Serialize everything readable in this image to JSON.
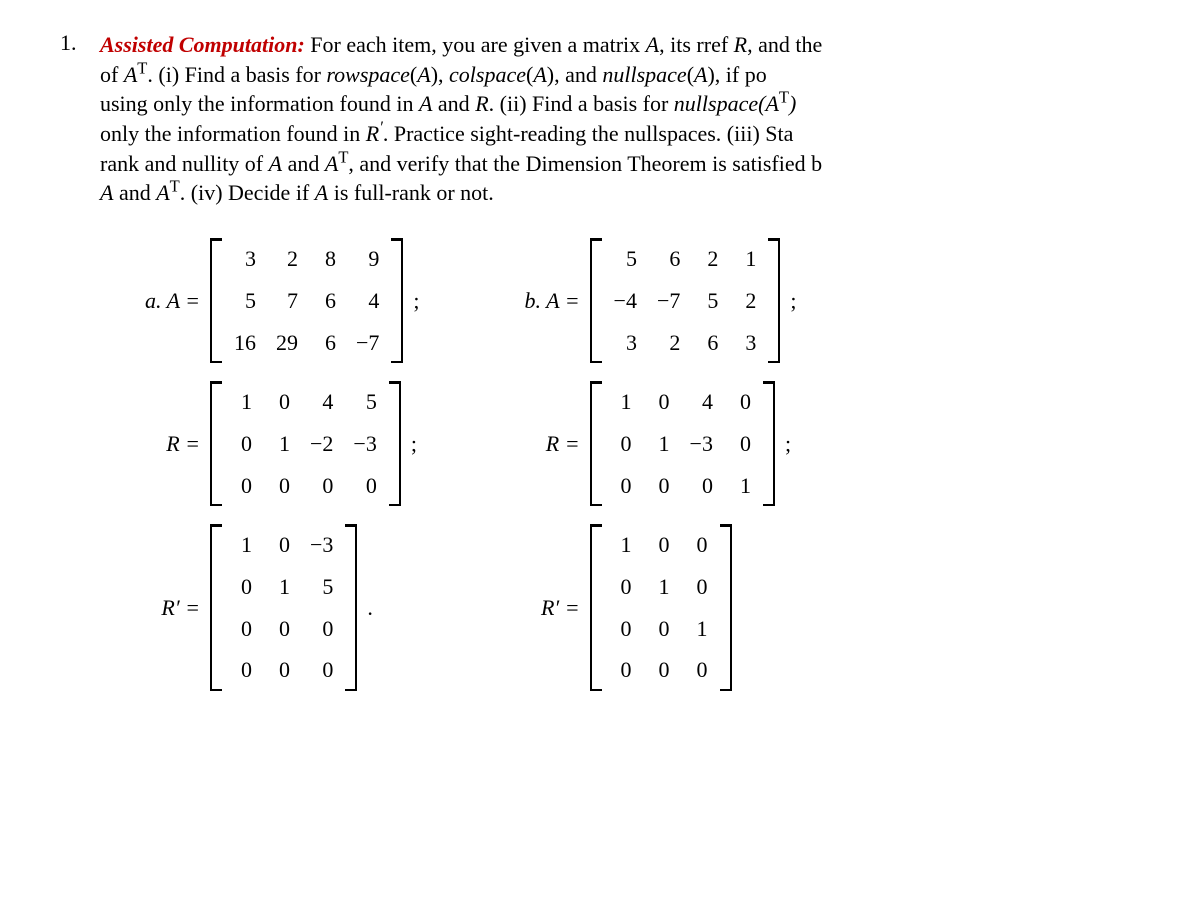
{
  "problem_number": "1.",
  "heading": "Assisted Computation:",
  "text_parts": {
    "p1": " For each item, you are given a matrix ",
    "A": "A",
    "p2": ",  its rref ",
    "R": "R",
    "p3": ",  and the",
    "p4": "of ",
    "AT": "A",
    "Tsup": "T",
    "p5": ". (i) Find a basis for ",
    "rowspace": "rowspace",
    "p6": "(",
    "A2": "A",
    "p7": "),  ",
    "colspace": "colspace",
    "p8": "(",
    "A3": "A",
    "p9": "),  and  ",
    "nullspace": "nullspace",
    "p10": "(",
    "A4": "A",
    "p11": "),  if  po",
    "p12": "using only the information found in ",
    "A5": "A",
    "p13": " and ",
    "R2": "R",
    "p14": ". (ii) Find a basis for ",
    "nullspace2": "nullspace(A",
    "Tsup2": "T",
    "paren2": ")",
    "p15": "only the information found in ",
    "R3": "R",
    "prime": "′",
    "p16": ". Practice sight-reading the nullspaces. (iii) Sta",
    "p17": "rank and nullity of ",
    "A6": "A",
    "p18": " and ",
    "A7": "A",
    "Tsup3": "T",
    "p19": ",  and verify that the Dimension Theorem is satisfied b",
    "p20": "",
    "A8": "A",
    "p21": " and ",
    "A9": "A",
    "Tsup4": "T",
    "p22": ". (iv) Decide if ",
    "A10": "A",
    "p23": " is full-rank or not."
  },
  "labels": {
    "a_A": "a.   A  =",
    "b_A": "b.   A  =",
    "R_eq": "R  =",
    "Rp_eq": "R′  =",
    "semicolon": ";",
    "period": "."
  },
  "chart_data": [
    {
      "type": "table",
      "name": "a.A",
      "rows": [
        [
          3,
          2,
          8,
          9
        ],
        [
          5,
          7,
          6,
          4
        ],
        [
          16,
          29,
          6,
          -7
        ]
      ]
    },
    {
      "type": "table",
      "name": "a.R",
      "rows": [
        [
          1,
          0,
          4,
          5
        ],
        [
          0,
          1,
          -2,
          -3
        ],
        [
          0,
          0,
          0,
          0
        ]
      ]
    },
    {
      "type": "table",
      "name": "a.Rprime",
      "rows": [
        [
          1,
          0,
          -3
        ],
        [
          0,
          1,
          5
        ],
        [
          0,
          0,
          0
        ],
        [
          0,
          0,
          0
        ]
      ]
    },
    {
      "type": "table",
      "name": "b.A",
      "rows": [
        [
          5,
          6,
          2,
          1
        ],
        [
          -4,
          -7,
          5,
          2
        ],
        [
          3,
          2,
          6,
          3
        ]
      ]
    },
    {
      "type": "table",
      "name": "b.R",
      "rows": [
        [
          1,
          0,
          4,
          0
        ],
        [
          0,
          1,
          -3,
          0
        ],
        [
          0,
          0,
          0,
          1
        ]
      ]
    },
    {
      "type": "table",
      "name": "b.Rprime",
      "rows": [
        [
          1,
          0,
          0
        ],
        [
          0,
          1,
          0
        ],
        [
          0,
          0,
          1
        ],
        [
          0,
          0,
          0
        ]
      ]
    }
  ]
}
